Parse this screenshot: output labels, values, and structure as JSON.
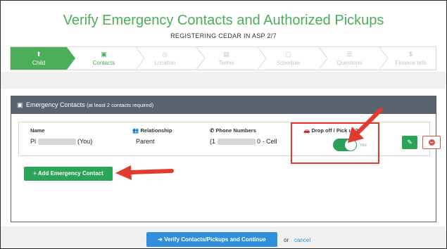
{
  "header": {
    "title": "Verify Emergency Contacts and Authorized Pickups",
    "subtitle": "REGISTERING CEDAR IN ASP 2/7"
  },
  "steps": [
    {
      "label": "Child",
      "icon": "child-icon",
      "glyph": "⬆",
      "state": "completed"
    },
    {
      "label": "Contacts",
      "icon": "contacts-icon",
      "glyph": "▣",
      "state": "current"
    },
    {
      "label": "Location",
      "icon": "location-icon",
      "glyph": "◎",
      "state": "upcoming"
    },
    {
      "label": "Terms",
      "icon": "terms-icon",
      "glyph": "▤",
      "state": "upcoming"
    },
    {
      "label": "Schedule",
      "icon": "calendar-icon",
      "glyph": "▢",
      "state": "upcoming"
    },
    {
      "label": "Questions",
      "icon": "list-icon",
      "glyph": "☰",
      "state": "upcoming"
    },
    {
      "label": "Finance Info",
      "icon": "dollar-icon",
      "glyph": "$",
      "state": "upcoming"
    }
  ],
  "panel": {
    "title": "Emergency Contacts",
    "note": "(at least 2 contacts required)"
  },
  "contact": {
    "name_label": "Name",
    "relationship_label": "Relationship",
    "phones_label": "Phone Numbers",
    "pickup_label": "Drop off / Pick up?",
    "name_prefix": "Pl",
    "name_suffix": "(You)",
    "relationship": "Parent",
    "phone_prefix": "(1",
    "phone_suffix": "0 - Cell",
    "pickup_toggle_label": "Yes",
    "pickup_enabled": true
  },
  "buttons": {
    "add_contact": "Add Emergency Contact",
    "verify": "Verify Contacts/Pickups and Continue",
    "or": "or",
    "cancel": "cancel"
  },
  "colors": {
    "brand_green": "#4bae58",
    "button_green": "#2aa556",
    "primary_blue": "#2f8fdc",
    "panel_header": "#5a6470",
    "annotation_red": "#e23a31"
  }
}
